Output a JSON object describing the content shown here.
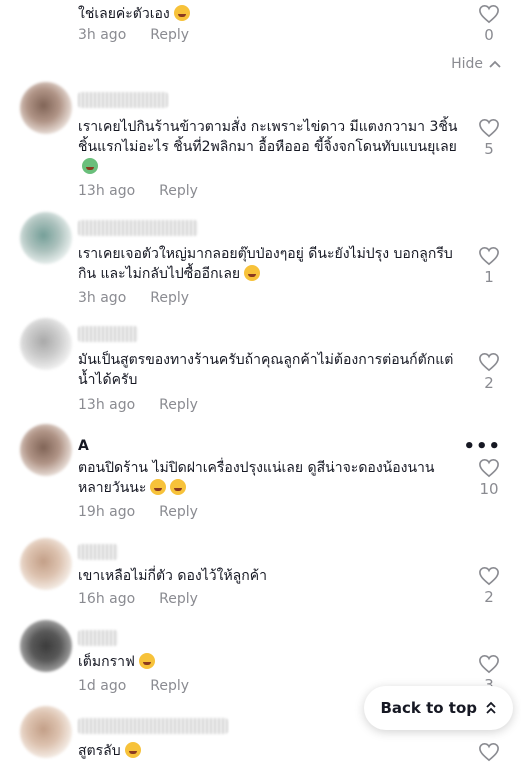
{
  "comments": [
    {
      "text": "ใช่เลยค่ะตัวเอง",
      "time": "3h ago",
      "reply": "Reply",
      "likes": "0"
    },
    {
      "text": "เราเคยไปกินร้านข้าวตามสั่ง กะเพราะไข่ดาว มีแตงกวามา 3ชิ้น ชิ้นแรกไม่อะไร ชิ้นที่2พลิกมา อื้อหือออ ขี้จิ้งจกโดนทับแบนยุเลย",
      "time": "13h ago",
      "reply": "Reply",
      "likes": "5"
    },
    {
      "text": "เราเคยเจอตัวใหญ่มากลอยตุ๊บป่องๆอยู่ ดีนะยังไม่ปรุง บอกลูกรีบกิน และไม่กลับไปซื้ออีกเลย",
      "time": "3h ago",
      "reply": "Reply",
      "likes": "1"
    },
    {
      "text": "มันเป็นสูตรของทางร้านครับถ้าคุณลูกค้าไม่ต้องการต่อนก์ตักแต่น้ำได้ครับ",
      "time": "13h ago",
      "reply": "Reply",
      "likes": "2"
    },
    {
      "username": "A",
      "text": "ตอนปิดร้าน ไม่ปิดฝาเครื่องปรุงแน่เลย ดูสีน่าจะดองน้องนานหลายวันนะ",
      "time": "19h ago",
      "reply": "Reply",
      "likes": "10"
    },
    {
      "text": "เขาเหลือไม่กี่ตัว ดองไว้ให้ลูกค้า",
      "time": "16h ago",
      "reply": "Reply",
      "likes": "2"
    },
    {
      "text": "เต็มกราฟ",
      "time": "1d ago",
      "reply": "Reply",
      "likes": "3"
    },
    {
      "text": "สูตรลับ"
    }
  ],
  "hide_label": "Hide",
  "back_to_top_label": "Back to top",
  "accent_color": "#161823",
  "muted_color": "#8a8b91"
}
